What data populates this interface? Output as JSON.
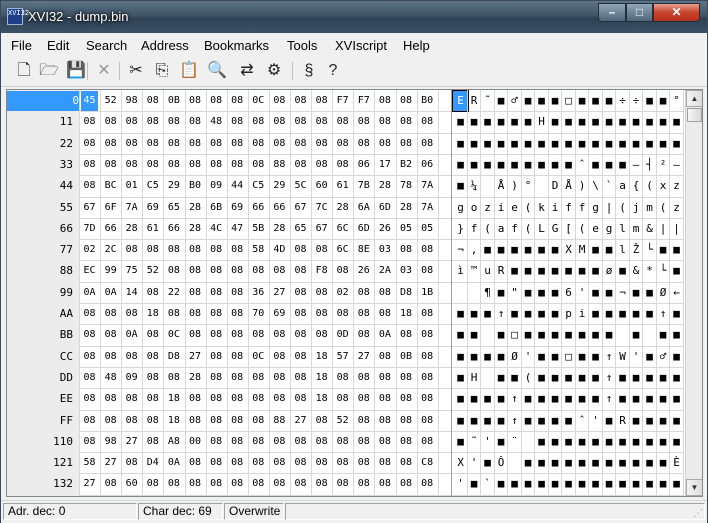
{
  "window": {
    "title": "XVI32 - dump.bin",
    "icon_text": "XVI32",
    "min_glyph": "–",
    "max_glyph": "□",
    "close_glyph": "✕"
  },
  "menu": [
    "File",
    "Edit",
    "Search",
    "Address",
    "Bookmarks",
    "Tools",
    "XVIscript",
    "Help"
  ],
  "toolbar": [
    {
      "name": "new-file-icon",
      "glyph": "🗋"
    },
    {
      "name": "open-folder-icon",
      "glyph": "🗁"
    },
    {
      "name": "save-icon",
      "glyph": "💾"
    },
    {
      "name": "close-file-icon",
      "glyph": "✕"
    },
    {
      "name": "cut-icon",
      "glyph": "✂"
    },
    {
      "name": "copy-icon",
      "glyph": "⎘"
    },
    {
      "name": "paste-icon",
      "glyph": "📋"
    },
    {
      "name": "find-icon",
      "glyph": "🔍"
    },
    {
      "name": "replace-icon",
      "glyph": "⇄"
    },
    {
      "name": "properties-icon",
      "glyph": "⚙"
    },
    {
      "name": "script-icon",
      "glyph": "§"
    },
    {
      "name": "context-help-icon",
      "glyph": "?"
    }
  ],
  "rows": [
    {
      "addr": "0",
      "hex": [
        "45",
        "52",
        "98",
        "08",
        "0B",
        "08",
        "08",
        "08",
        "0C",
        "08",
        "08",
        "08",
        "F7",
        "F7",
        "08",
        "08",
        "B0"
      ],
      "chars": [
        "E",
        "R",
        "˜",
        "■",
        "♂",
        "■",
        "■",
        "■",
        "□",
        "■",
        "■",
        "■",
        "÷",
        "÷",
        "■",
        "■",
        "°"
      ]
    },
    {
      "addr": "11",
      "hex": [
        "08",
        "08",
        "08",
        "08",
        "08",
        "08",
        "48",
        "08",
        "08",
        "08",
        "08",
        "08",
        "08",
        "08",
        "08",
        "08",
        "08"
      ],
      "chars": [
        "■",
        "■",
        "■",
        "■",
        "■",
        "■",
        "H",
        "■",
        "■",
        "■",
        "■",
        "■",
        "■",
        "■",
        "■",
        "■",
        "■"
      ]
    },
    {
      "addr": "22",
      "hex": [
        "08",
        "08",
        "08",
        "08",
        "08",
        "08",
        "08",
        "08",
        "08",
        "08",
        "08",
        "08",
        "08",
        "08",
        "08",
        "08",
        "08"
      ],
      "chars": [
        "■",
        "■",
        "■",
        "■",
        "■",
        "■",
        "■",
        "■",
        "■",
        "■",
        "■",
        "■",
        "■",
        "■",
        "■",
        "■",
        "■"
      ]
    },
    {
      "addr": "33",
      "hex": [
        "08",
        "08",
        "08",
        "08",
        "08",
        "08",
        "08",
        "08",
        "08",
        "88",
        "08",
        "08",
        "08",
        "06",
        "17",
        "B2",
        "06"
      ],
      "chars": [
        "■",
        "■",
        "■",
        "■",
        "■",
        "■",
        "■",
        "■",
        "■",
        "ˆ",
        "■",
        "■",
        "■",
        "–",
        "┤",
        "²",
        "–"
      ]
    },
    {
      "addr": "44",
      "hex": [
        "08",
        "BC",
        "01",
        "C5",
        "29",
        "B0",
        "09",
        "44",
        "C5",
        "29",
        "5C",
        "60",
        "61",
        "7B",
        "28",
        "78",
        "7A"
      ],
      "chars": [
        "■",
        "¼",
        "",
        "Å",
        ")",
        "°",
        "",
        "D",
        "Å",
        ")",
        "\\",
        "`",
        "a",
        "{",
        "(",
        "x",
        "z"
      ]
    },
    {
      "addr": "55",
      "hex": [
        "67",
        "6F",
        "7A",
        "69",
        "65",
        "28",
        "6B",
        "69",
        "66",
        "66",
        "67",
        "7C",
        "28",
        "6A",
        "6D",
        "28",
        "7A"
      ],
      "chars": [
        "g",
        "o",
        "z",
        "i",
        "e",
        "(",
        "k",
        "i",
        "f",
        "f",
        "g",
        "|",
        "(",
        "j",
        "m",
        "(",
        "z"
      ]
    },
    {
      "addr": "66",
      "hex": [
        "7D",
        "66",
        "28",
        "61",
        "66",
        "28",
        "4C",
        "47",
        "5B",
        "28",
        "65",
        "67",
        "6C",
        "6D",
        "26",
        "05",
        "05"
      ],
      "chars": [
        "}",
        "f",
        "(",
        "a",
        "f",
        "(",
        "L",
        "G",
        "[",
        "(",
        "e",
        "g",
        "l",
        "m",
        "&",
        "|",
        "|"
      ]
    },
    {
      "addr": "77",
      "hex": [
        "02",
        "2C",
        "08",
        "08",
        "08",
        "08",
        "08",
        "08",
        "58",
        "4D",
        "08",
        "08",
        "6C",
        "8E",
        "03",
        "08",
        "08"
      ],
      "chars": [
        "¬",
        ",",
        "■",
        "■",
        "■",
        "■",
        "■",
        "■",
        "X",
        "M",
        "■",
        "■",
        "l",
        "Ž",
        "└",
        "■",
        "■"
      ]
    },
    {
      "addr": "88",
      "hex": [
        "EC",
        "99",
        "75",
        "52",
        "08",
        "08",
        "08",
        "08",
        "08",
        "08",
        "08",
        "F8",
        "08",
        "26",
        "2A",
        "03",
        "08"
      ],
      "chars": [
        "ì",
        "™",
        "u",
        "R",
        "■",
        "■",
        "■",
        "■",
        "■",
        "■",
        "■",
        "ø",
        "■",
        "&",
        "*",
        "└",
        "■"
      ]
    },
    {
      "addr": "99",
      "hex": [
        "0A",
        "0A",
        "14",
        "08",
        "22",
        "08",
        "08",
        "08",
        "36",
        "27",
        "08",
        "08",
        "02",
        "08",
        "08",
        "D8",
        "1B"
      ],
      "chars": [
        "",
        "",
        "¶",
        "■",
        "\"",
        "■",
        "■",
        "■",
        "6",
        "'",
        "■",
        "■",
        "¬",
        "■",
        "■",
        "Ø",
        "←"
      ]
    },
    {
      "addr": "AA",
      "hex": [
        "08",
        "08",
        "08",
        "18",
        "08",
        "08",
        "08",
        "08",
        "70",
        "69",
        "08",
        "08",
        "08",
        "08",
        "08",
        "18",
        "08"
      ],
      "chars": [
        "■",
        "■",
        "■",
        "↑",
        "■",
        "■",
        "■",
        "■",
        "p",
        "i",
        "■",
        "■",
        "■",
        "■",
        "■",
        "↑",
        "■"
      ]
    },
    {
      "addr": "BB",
      "hex": [
        "08",
        "08",
        "0A",
        "08",
        "0C",
        "08",
        "08",
        "08",
        "08",
        "08",
        "08",
        "08",
        "0D",
        "08",
        "0A",
        "08",
        "08"
      ],
      "chars": [
        "■",
        "■",
        "",
        "■",
        "□",
        "■",
        "■",
        "■",
        "■",
        "■",
        "■",
        "■",
        "",
        "■",
        "",
        "■",
        "■"
      ]
    },
    {
      "addr": "CC",
      "hex": [
        "08",
        "08",
        "08",
        "08",
        "D8",
        "27",
        "08",
        "08",
        "0C",
        "08",
        "08",
        "18",
        "57",
        "27",
        "08",
        "0B",
        "08"
      ],
      "chars": [
        "■",
        "■",
        "■",
        "■",
        "Ø",
        "'",
        "■",
        "■",
        "□",
        "■",
        "■",
        "↑",
        "W",
        "'",
        "■",
        "♂",
        "■"
      ]
    },
    {
      "addr": "DD",
      "hex": [
        "08",
        "48",
        "09",
        "08",
        "08",
        "28",
        "08",
        "08",
        "08",
        "08",
        "08",
        "18",
        "08",
        "08",
        "08",
        "08",
        "08"
      ],
      "chars": [
        "■",
        "H",
        "",
        "■",
        "■",
        "(",
        "■",
        "■",
        "■",
        "■",
        "■",
        "↑",
        "■",
        "■",
        "■",
        "■",
        "■"
      ]
    },
    {
      "addr": "EE",
      "hex": [
        "08",
        "08",
        "08",
        "08",
        "18",
        "08",
        "08",
        "08",
        "08",
        "08",
        "08",
        "18",
        "08",
        "08",
        "08",
        "08",
        "08"
      ],
      "chars": [
        "■",
        "■",
        "■",
        "■",
        "↑",
        "■",
        "■",
        "■",
        "■",
        "■",
        "■",
        "↑",
        "■",
        "■",
        "■",
        "■",
        "■"
      ]
    },
    {
      "addr": "FF",
      "hex": [
        "08",
        "08",
        "08",
        "08",
        "18",
        "08",
        "08",
        "08",
        "08",
        "88",
        "27",
        "08",
        "52",
        "08",
        "08",
        "08",
        "08"
      ],
      "chars": [
        "■",
        "■",
        "■",
        "■",
        "↑",
        "■",
        "■",
        "■",
        "■",
        "ˆ",
        "'",
        "■",
        "R",
        "■",
        "■",
        "■",
        "■"
      ]
    },
    {
      "addr": "110",
      "hex": [
        "08",
        "98",
        "27",
        "08",
        "A8",
        "00",
        "08",
        "08",
        "08",
        "08",
        "08",
        "08",
        "08",
        "08",
        "08",
        "08",
        "08"
      ],
      "chars": [
        "■",
        "˜",
        "'",
        "■",
        "¨",
        "",
        "■",
        "■",
        "■",
        "■",
        "■",
        "■",
        "■",
        "■",
        "■",
        "■",
        "■"
      ]
    },
    {
      "addr": "121",
      "hex": [
        "58",
        "27",
        "08",
        "D4",
        "0A",
        "08",
        "08",
        "08",
        "08",
        "08",
        "08",
        "08",
        "08",
        "08",
        "08",
        "08",
        "C8"
      ],
      "chars": [
        "X",
        "'",
        "■",
        "Ô",
        "",
        "■",
        "■",
        "■",
        "■",
        "■",
        "■",
        "■",
        "■",
        "■",
        "■",
        "■",
        "È"
      ]
    },
    {
      "addr": "132",
      "hex": [
        "27",
        "08",
        "60",
        "08",
        "08",
        "08",
        "08",
        "08",
        "08",
        "08",
        "08",
        "08",
        "08",
        "08",
        "08",
        "08",
        "08"
      ],
      "chars": [
        "'",
        "■",
        "`",
        "■",
        "■",
        "■",
        "■",
        "■",
        "■",
        "■",
        "■",
        "■",
        "■",
        "■",
        "■",
        "■",
        "■"
      ]
    }
  ],
  "cursor": {
    "row": 0,
    "col": 0
  },
  "scroll": {
    "up_glyph": "▲",
    "down_glyph": "▼"
  },
  "status": {
    "address": "Adr. dec: 0",
    "char": "Char dec: 69",
    "mode": "Overwrite",
    "grip": "⋰"
  },
  "colors": {
    "selection": "#3399ff",
    "address_bg": "#ececec",
    "grid_line": "#d7d7d7"
  }
}
